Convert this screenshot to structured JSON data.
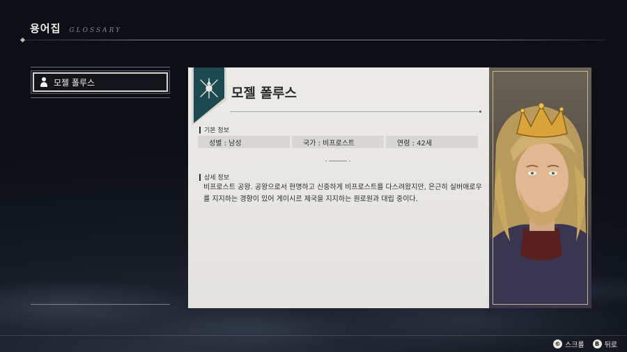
{
  "header": {
    "title": "용어집",
    "subtitle": "GLOSSARY"
  },
  "sidebar": {
    "items": [
      {
        "label": "모젤 폴루스",
        "icon": "person-icon",
        "selected": true
      }
    ]
  },
  "entry": {
    "title": "모젤 폴루스",
    "crest_icon": "crest-icon",
    "basic_info_heading": "기본 정보",
    "basic_info": {
      "gender": "성별 : 남성",
      "nation": "국가 : 비프로스트",
      "age": "연령 : 42세"
    },
    "detail_heading": "상세 정보",
    "description": "비프로스트 공왕. 공왕으로서 현명하고 신중하게 비프로스트를 다스려왔지만, 은근히 실버애로우를 지지하는 경향이 있어 게이시르 제국을 지지하는 원로원과 대립 중이다."
  },
  "portrait": {
    "icon": "crowned-king-portrait"
  },
  "footer": {
    "hints": [
      {
        "glyph": "©",
        "label": "스크롤"
      },
      {
        "glyph": "B",
        "label": "뒤로"
      }
    ]
  },
  "colors": {
    "banner": "#1d4a50",
    "panel": "#ecebe7",
    "frame_gold": "#c8b88a",
    "crown_gold": "#d9a53a"
  }
}
